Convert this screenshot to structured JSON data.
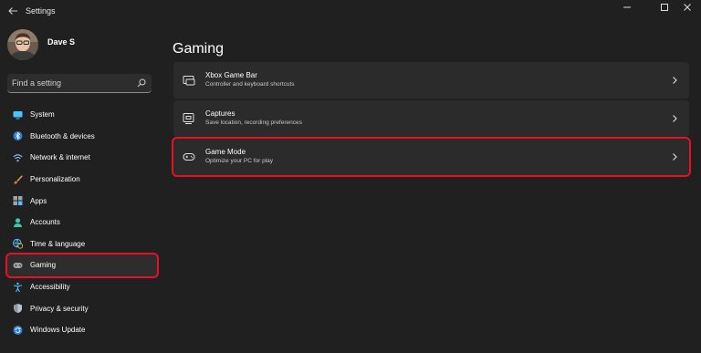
{
  "window": {
    "title": "Settings"
  },
  "user": {
    "name": "Dave S"
  },
  "search": {
    "placeholder": "Find a setting"
  },
  "sidebar": {
    "items": [
      {
        "label": "System",
        "icon": "monitor-icon"
      },
      {
        "label": "Bluetooth & devices",
        "icon": "bluetooth-icon"
      },
      {
        "label": "Network & internet",
        "icon": "wifi-icon"
      },
      {
        "label": "Personalization",
        "icon": "brush-icon"
      },
      {
        "label": "Apps",
        "icon": "apps-icon"
      },
      {
        "label": "Accounts",
        "icon": "person-icon"
      },
      {
        "label": "Time & language",
        "icon": "globe-clock-icon"
      },
      {
        "label": "Gaming",
        "icon": "controller-icon",
        "selected": true
      },
      {
        "label": "Accessibility",
        "icon": "accessibility-icon"
      },
      {
        "label": "Privacy & security",
        "icon": "shield-icon"
      },
      {
        "label": "Windows Update",
        "icon": "update-icon"
      }
    ]
  },
  "main": {
    "title": "Gaming",
    "cards": [
      {
        "title": "Xbox Game Bar",
        "subtitle": "Controller and keyboard shortcuts",
        "icon": "game-bar-icon"
      },
      {
        "title": "Captures",
        "subtitle": "Save location, recording preferences",
        "icon": "capture-icon"
      },
      {
        "title": "Game Mode",
        "subtitle": "Optimize your PC for play",
        "icon": "game-mode-icon",
        "highlighted": true
      }
    ]
  },
  "colors": {
    "background": "#202020",
    "card": "#2b2b2b",
    "highlight_outline": "#e81123",
    "accent": "#4cc2ff"
  }
}
